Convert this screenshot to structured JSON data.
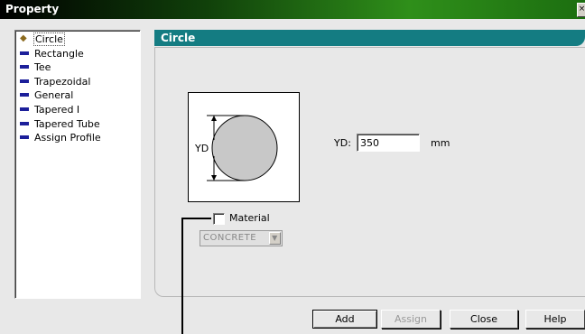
{
  "window": {
    "title": "Property",
    "close_glyph": "×"
  },
  "tree": {
    "items": [
      {
        "label": "Circle",
        "icon": "diamond-icon",
        "selected": true
      },
      {
        "label": "Rectangle",
        "icon": "bar-icon"
      },
      {
        "label": "Tee",
        "icon": "bar-icon"
      },
      {
        "label": "Trapezoidal",
        "icon": "bar-icon"
      },
      {
        "label": "General",
        "icon": "bar-icon"
      },
      {
        "label": "Tapered I",
        "icon": "bar-icon"
      },
      {
        "label": "Tapered Tube",
        "icon": "bar-icon"
      },
      {
        "label": "Assign Profile",
        "icon": "bar-icon"
      }
    ]
  },
  "section": {
    "title": "Circle"
  },
  "diagram": {
    "dimension_label": "YD"
  },
  "fields": {
    "yd_label": "YD:",
    "yd_value": "350",
    "unit": "mm"
  },
  "material": {
    "label": "Material",
    "checked": false,
    "select_value": "CONCRETE",
    "enabled": false
  },
  "buttons": {
    "add": "Add",
    "assign": "Assign",
    "close": "Close",
    "help": "Help"
  },
  "colors": {
    "header_teal": "#147c82",
    "tree_bullet": "#1c1f9a",
    "titlebar_green": "#2f8f1a"
  }
}
